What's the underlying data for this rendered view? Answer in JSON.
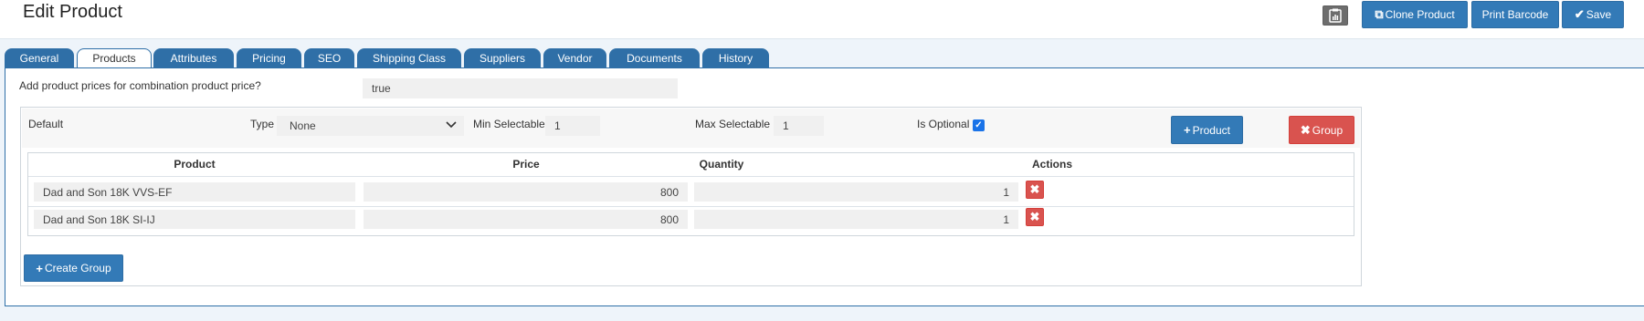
{
  "header": {
    "title": "Edit Product",
    "clipboard_icon": "clipboard-icon",
    "clone_label": "Clone Product",
    "print_label": "Print Barcode",
    "save_label": "Save"
  },
  "tabs": [
    {
      "label": "General"
    },
    {
      "label": "Products"
    },
    {
      "label": "Attributes"
    },
    {
      "label": "Pricing"
    },
    {
      "label": "SEO"
    },
    {
      "label": "Shipping Class"
    },
    {
      "label": "Suppliers"
    },
    {
      "label": "Vendor"
    },
    {
      "label": "Documents"
    },
    {
      "label": "History"
    }
  ],
  "active_tab": "Products",
  "combination": {
    "question": "Add product prices for combination product price?",
    "value": "true"
  },
  "group": {
    "name": "Default",
    "type_label": "Type",
    "type_value": "None",
    "min_label": "Min Selectable",
    "min_value": "1",
    "max_label": "Max Selectable",
    "max_value": "1",
    "optional_label": "Is Optional",
    "optional_checked": true,
    "add_product_label": "Product",
    "remove_group_label": "Group"
  },
  "table": {
    "headers": [
      "Product",
      "Price",
      "Quantity",
      "Actions"
    ],
    "rows": [
      {
        "product": "Dad and Son 18K VVS-EF",
        "price": "800",
        "quantity": "1"
      },
      {
        "product": "Dad and Son 18K SI-IJ",
        "price": "800",
        "quantity": "1"
      }
    ]
  },
  "create_group_label": "Create Group",
  "colors": {
    "primary": "#337ab7",
    "danger": "#d9534f",
    "tab": "#2f6fa7",
    "background": "#eef4fa"
  }
}
